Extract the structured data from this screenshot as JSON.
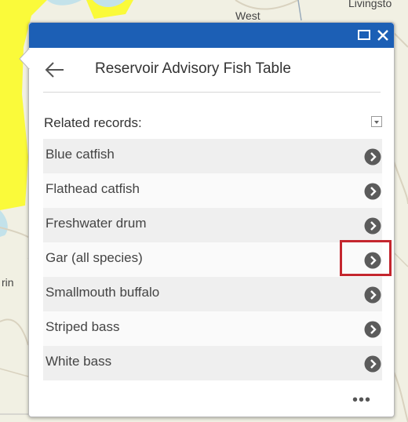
{
  "map": {
    "labels": {
      "west": "West",
      "livingston": "Livingsto",
      "rin": "rin"
    },
    "colors": {
      "land": "#f1f0e3",
      "highlight": "#fafa3a",
      "water": "#c3e2ea",
      "roads": "#d9d2bf"
    }
  },
  "popup": {
    "header_color": "#1c5fb5",
    "title": "Reservoir Advisory Fish Table",
    "back_icon": "arrow-left-icon",
    "maximize_icon": "maximize-icon",
    "close_icon": "close-icon",
    "related_label": "Related records:",
    "toggle_icon": "collapse-toggle-icon",
    "records": [
      {
        "name": "Blue catfish"
      },
      {
        "name": "Flathead catfish"
      },
      {
        "name": "Freshwater drum"
      },
      {
        "name": "Gar (all species)"
      },
      {
        "name": "Smallmouth buffalo"
      },
      {
        "name": "Striped bass"
      },
      {
        "name": "White bass"
      }
    ],
    "row_arrow_icon": "chevron-right-circle-icon",
    "highlight_color": "#c4262e",
    "more_label": "•••"
  }
}
